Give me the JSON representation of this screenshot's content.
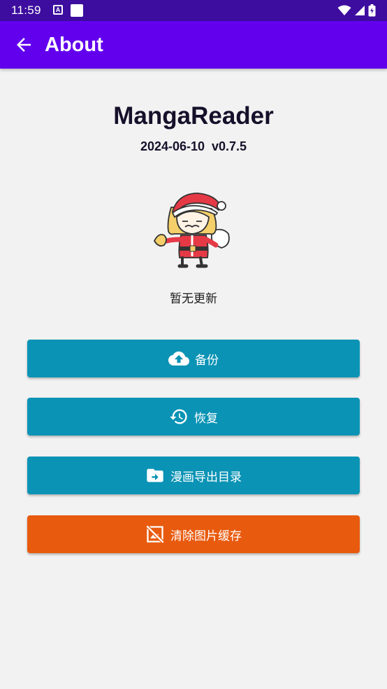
{
  "status_bar": {
    "time": "11:59",
    "notification_letter": "A"
  },
  "app_bar": {
    "title": "About",
    "back_icon": "arrow-back-icon"
  },
  "about": {
    "app_name": "MangaReader",
    "version_line": "2024-06-10  v0.7.5",
    "mascot": "santa-mascot-image",
    "update_status": "暂无更新"
  },
  "buttons": {
    "backup": {
      "label": "备份",
      "icon": "cloud-upload-icon"
    },
    "restore": {
      "label": "恢复",
      "icon": "history-icon"
    },
    "export": {
      "label": "漫画导出目录",
      "icon": "folder-export-icon"
    },
    "clear_cache": {
      "label": "清除图片缓存",
      "icon": "hide-image-icon"
    }
  },
  "colors": {
    "status_bar": "#3c0d9e",
    "app_bar": "#6200ee",
    "button_primary": "#0a93b5",
    "button_danger": "#e85a0e",
    "background": "#f2f2f2"
  }
}
